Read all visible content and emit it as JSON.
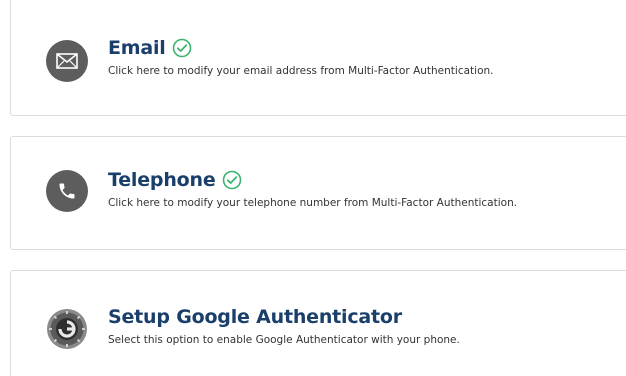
{
  "options": [
    {
      "icon": "envelope-icon",
      "title": "Email",
      "verified": true,
      "description": "Click here to modify your email address from Multi-Factor Authentication."
    },
    {
      "icon": "phone-icon",
      "title": "Telephone",
      "verified": true,
      "description": "Click here to modify your telephone number from Multi-Factor Authentication."
    },
    {
      "icon": "google-authenticator-icon",
      "title": "Setup Google Authenticator",
      "verified": false,
      "description": "Select this option to enable Google Authenticator with your phone."
    }
  ],
  "colors": {
    "title": "#1a3f6b",
    "check": "#3cb371",
    "icon_bg": "#5d5d5d"
  }
}
